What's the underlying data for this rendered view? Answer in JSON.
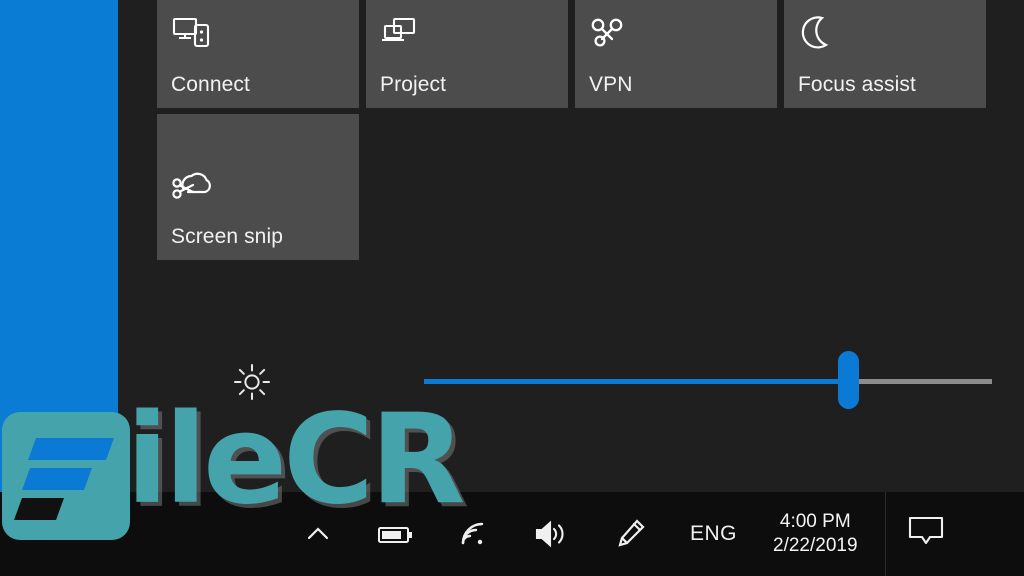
{
  "desktop": {
    "wallpaper_color": "#0a7cd4",
    "panel_bg": "#1f1f1f",
    "taskbar_bg": "#0d0d0d",
    "accent_color": "#0b7ad4",
    "tile_color": "#4c4c4c"
  },
  "action_center": {
    "tiles": [
      {
        "label": "Connect",
        "icon": "connect-icon"
      },
      {
        "label": "Project",
        "icon": "project-icon"
      },
      {
        "label": "VPN",
        "icon": "vpn-icon"
      },
      {
        "label": "Focus assist",
        "icon": "moon-icon"
      },
      {
        "label": "Screen snip",
        "icon": "scissors-icon"
      }
    ],
    "brightness": {
      "icon": "brightness-icon",
      "value": 75,
      "min": 0,
      "max": 100
    }
  },
  "taskbar": {
    "tray": [
      {
        "name": "show-hidden-icons",
        "icon": "chevron-up-icon"
      },
      {
        "name": "battery",
        "icon": "battery-icon"
      },
      {
        "name": "network",
        "icon": "wifi-icon"
      },
      {
        "name": "volume",
        "icon": "speaker-icon"
      },
      {
        "name": "pen-workspace",
        "icon": "pen-icon"
      }
    ],
    "language": "ENG",
    "clock": {
      "time": "4:00 PM",
      "date": "2/22/2019"
    },
    "action_center_button": "action-center-icon"
  },
  "watermark": {
    "text": "ileCR",
    "logo_color": "#45a3ab",
    "bar_color": "#0b7ad4"
  }
}
